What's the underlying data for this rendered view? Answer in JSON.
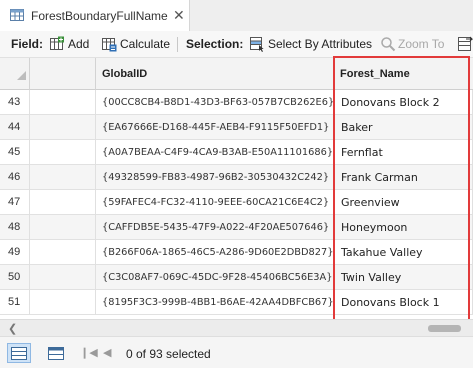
{
  "tab": {
    "title": "ForestBoundaryFullName",
    "close_glyph": "✕"
  },
  "toolbar": {
    "field_label": "Field:",
    "add_label": "Add",
    "calculate_label": "Calculate",
    "selection_label": "Selection:",
    "select_by_attributes_label": "Select By Attributes",
    "zoom_to_label": "Zoom To"
  },
  "table": {
    "columns": [
      "",
      "",
      "GlobalID",
      "Forest_Name"
    ],
    "rows": [
      {
        "num": "43",
        "global_id": "{00CC8CB4-B8D1-43D3-BF63-057B7CB262E6}",
        "forest_name": "Donovans Block 2"
      },
      {
        "num": "44",
        "global_id": "{EA67666E-D168-445F-AEB4-F9115F50EFD1}",
        "forest_name": "Baker"
      },
      {
        "num": "45",
        "global_id": "{A0A7BEAA-C4F9-4CA9-B3AB-E50A11101686}",
        "forest_name": "Fernflat"
      },
      {
        "num": "46",
        "global_id": "{49328599-FB83-4987-96B2-30530432C242}",
        "forest_name": "Frank Carman"
      },
      {
        "num": "47",
        "global_id": "{59FAFEC4-FC32-4110-9EEE-60CA21C6E4C2}",
        "forest_name": "Greenview"
      },
      {
        "num": "48",
        "global_id": "{CAFFDB5E-5435-47F9-A022-4F20AE507646}",
        "forest_name": "Honeymoon"
      },
      {
        "num": "49",
        "global_id": "{B266F06A-1865-46C5-A286-9D60E2DBD827}",
        "forest_name": "Takahue Valley"
      },
      {
        "num": "50",
        "global_id": "{C3C08AF7-069C-45DC-9F28-45406BC56E3A}",
        "forest_name": "Twin Valley"
      },
      {
        "num": "51",
        "global_id": "{8195F3C3-999B-4BB1-B6AE-42AA4DBFCB67}",
        "forest_name": "Donovans Block 1"
      }
    ]
  },
  "statusbar": {
    "selection_text": "0 of 93 selected"
  },
  "colors": {
    "highlight_border": "#e23a3a",
    "active_view_bg": "#cfe3f7"
  },
  "icons": [
    "table-icon",
    "add-field-icon",
    "calculate-icon",
    "select-by-attributes-icon",
    "zoom-to-icon",
    "switch-selection-icon",
    "table-view-icon",
    "grid-view-icon",
    "first-record-icon",
    "previous-record-icon"
  ]
}
